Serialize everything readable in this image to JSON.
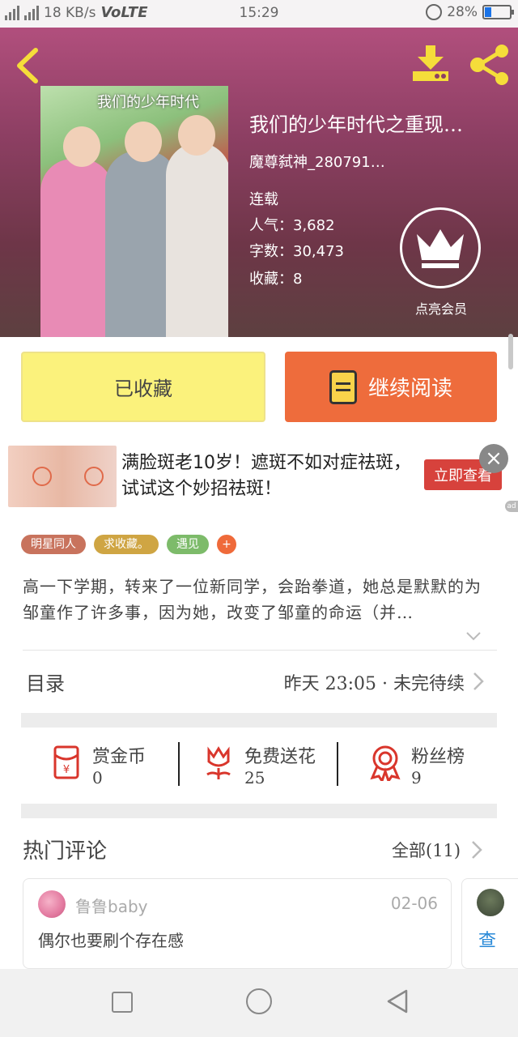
{
  "status_bar": {
    "network_labels": [
      "4G",
      "2G"
    ],
    "speed": "18 KB/s",
    "volte": "VoLTE",
    "time": "15:29",
    "battery_percent": "28%",
    "battery_level": 0.28,
    "battery_color": "#1a73e8"
  },
  "book": {
    "cover_title": "我们的少年时代",
    "title": "我们的少年时代之重现…",
    "author": "魔尊弑神_280791…",
    "status": "连载",
    "popularity": "人气：3,682",
    "word_count": "字数：30,473",
    "favorites": "收藏：8",
    "vip_label": "点亮会员"
  },
  "actions": {
    "collected_label": "已收藏",
    "read_label": "继续阅读"
  },
  "ad": {
    "text": "满脸斑老10岁！遮斑不如对症祛斑，试试这个妙招祛斑！",
    "button": "立即查看",
    "close": "×",
    "mark": "ad"
  },
  "tags": [
    {
      "label": "明星同人",
      "color": "#c8735d"
    },
    {
      "label": "求收藏。",
      "color": "#cfa543"
    },
    {
      "label": "遇见",
      "color": "#7dbb6a"
    },
    {
      "label": "+",
      "color": "#ef6a3a"
    }
  ],
  "description": "高一下学期，转来了一位新同学，会跆拳道，她总是默默的为邹童作了许多事，因为她，改变了邹童的命运（并…",
  "catalog": {
    "label": "目录",
    "status": "昨天 23:05 · 未完待续"
  },
  "stats": [
    {
      "name": "赏金币",
      "value": "0"
    },
    {
      "name": "免费送花",
      "value": "25"
    },
    {
      "name": "粉丝榜",
      "value": "9"
    }
  ],
  "comments": {
    "title": "热门评论",
    "all_link": "全部(11)",
    "items": [
      {
        "user": "鲁鲁baby",
        "date": "02-06",
        "text": "偶尔也要刷个存在感"
      }
    ],
    "more_label": "查"
  },
  "colors": {
    "accent_orange": "#ee6c3c",
    "collected_yellow": "#fbf27c",
    "icon_red": "#d9362c"
  }
}
